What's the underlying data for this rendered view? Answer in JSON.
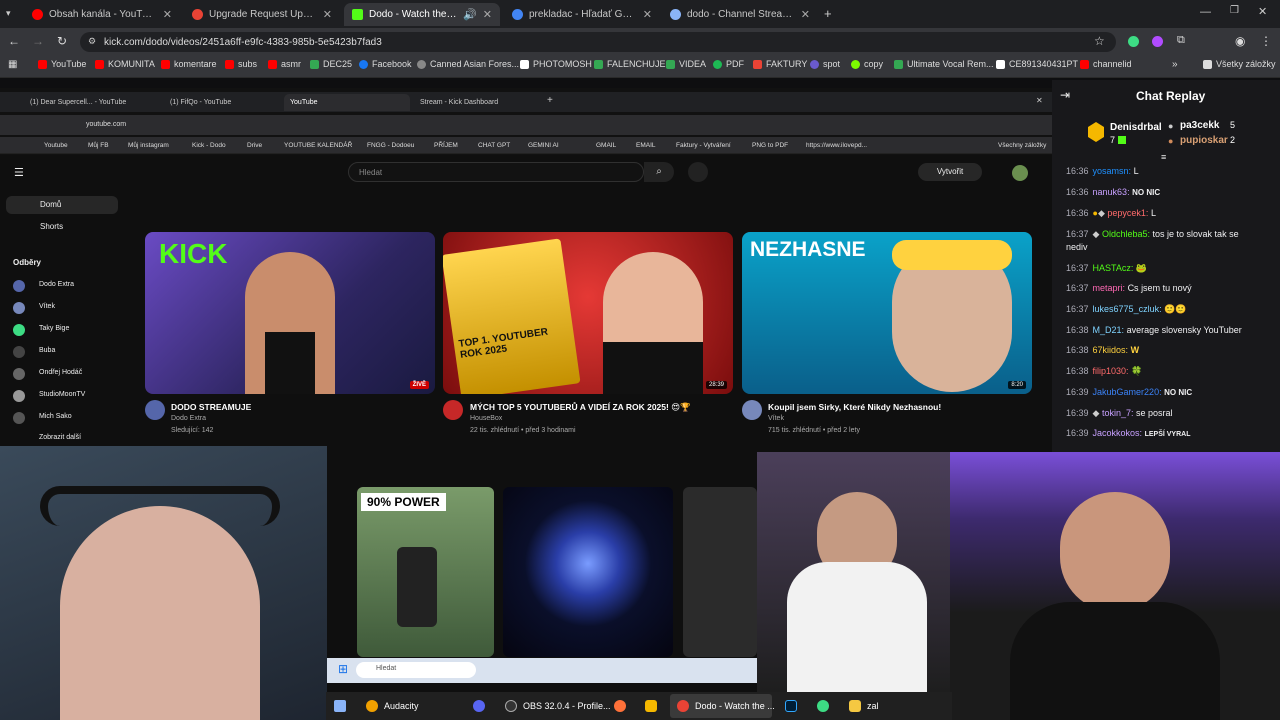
{
  "browser": {
    "tabs": [
      {
        "label": "Obsah kanála - YouTube Studio",
        "color": "#ff0000"
      },
      {
        "label": "Upgrade Request Update - fifq",
        "color": "#ea4335"
      },
      {
        "label": "Dodo - Watch the VOD on",
        "color": "#53fc18"
      },
      {
        "label": "prekladac - Hľadať Googlom",
        "color": "#4285f4"
      },
      {
        "label": "dodo - Channel Streams on Kic",
        "color": "#8ab4f8"
      }
    ],
    "url": "kick.com/dodo/videos/2451a6ff-e9fc-4383-985b-5e5423b7fad3",
    "bookmarks": [
      "YouTube",
      "KOMUNITA",
      "komentare",
      "subs",
      "asmr",
      "DEC25",
      "Facebook",
      "Canned Asian Fores...",
      "PHOTOMOSH",
      "FALENCHUJE",
      "VIDEA",
      "PDF",
      "FAKTURY",
      "spot",
      "copy",
      "Ultimate Vocal Rem...",
      "CE891340431PT",
      "channelid"
    ],
    "all_bookmarks": "Všetky záložky"
  },
  "inner": {
    "tabs": [
      "(1) Dear Supercell... - YouTube",
      "(1) FifQo - YouTube",
      "YouTube",
      "Stream - Kick Dashboard"
    ],
    "url": "youtube.com",
    "bookmarks": [
      "Youtube",
      "Můj FB",
      "Můj instagram",
      "Kick - Dodo",
      "Drive",
      "YOUTUBE KALENDÁŘ",
      "FNGG - Dodoeu",
      "PŘÍJEM",
      "CHAT GPT",
      "GEMINI AI",
      "GMAIL",
      "EMAIL",
      "Faktury - Vytváření",
      "PNG to PDF",
      "https://www.ilovepd..."
    ],
    "all_bookmarks": "Všechny záložky",
    "search_placeholder": "Hledat",
    "create_label": "Vytvořit",
    "sidebar": {
      "home": "Domů",
      "shorts": "Shorts",
      "subs": "Odběry",
      "channels": [
        "Dodo Extra",
        "Vítek",
        "Taky Bige",
        "Buba",
        "Ondřej Hodáč",
        "StudioMoonTV",
        "Mich Sako"
      ],
      "show_all": "Zobrazit další"
    },
    "videos": [
      {
        "title": "DODO STREAMUJE",
        "channel": "Dodo Extra",
        "meta": "Sledující: 142",
        "badge": "ŽIVĚ",
        "thumb_text": "KICK"
      },
      {
        "title": "MÝCH TOP 5 YOUTUBERŮ A VIDEÍ ZA ROK 2025! 😍🏆",
        "channel": "HouseBox",
        "meta": "22 tis. zhlédnutí • před 3 hodinami",
        "badge": "28:39",
        "thumb_text": "TOP 1. YOUTUBER ROK 2025"
      },
      {
        "title": "Koupil jsem Sirky, Které Nikdy Nezhasnou!",
        "channel": "Vítek",
        "meta": "715 tis. zhlédnutí • před 2 lety",
        "badge": "8:20",
        "thumb_text": "NEZHASNE"
      }
    ],
    "shorts_thumb": "90% POWER",
    "win_search": "Hledat"
  },
  "chat": {
    "title": "Chat Replay",
    "leaders": [
      {
        "name": "Denisdrbal",
        "count": "7"
      },
      {
        "name": "pa3cekk",
        "count": "5"
      },
      {
        "name": "pupioskar",
        "count": "2"
      }
    ],
    "messages": [
      {
        "time": "16:36",
        "user": "yosamsn:",
        "text": "L",
        "color": "#1e90ff"
      },
      {
        "time": "16:36",
        "user": "nanuk63:",
        "text": "NO NIC",
        "color": "#c7a0ff"
      },
      {
        "time": "16:36",
        "user": "pepycek1:",
        "text": "L",
        "color": "#ff6b6b"
      },
      {
        "time": "16:37",
        "user": "Oldchleba5:",
        "text": "tos je to slovak tak se",
        "text2": "nediv",
        "color": "#53fc18"
      },
      {
        "time": "16:37",
        "user": "HASTAcz:",
        "text": "🐸",
        "color": "#53fc18"
      },
      {
        "time": "16:37",
        "user": "metapri:",
        "text": "Cs jsem tu nový",
        "color": "#ff69b4"
      },
      {
        "time": "16:37",
        "user": "lukes6775_czluk:",
        "text": "🙂🙂",
        "color": "#7fd3ff"
      },
      {
        "time": "16:38",
        "user": "M_D21:",
        "text": "average slovensky YouTuber",
        "color": "#7fd3ff"
      },
      {
        "time": "16:38",
        "user": "67kiidos:",
        "text": "W",
        "color": "#ffd23f"
      },
      {
        "time": "16:38",
        "user": "filip1030:",
        "text": "🍀",
        "color": "#ff6b6b"
      },
      {
        "time": "16:39",
        "user": "JakubGamer220:",
        "text": "NO NIC",
        "color": "#3b82f6"
      },
      {
        "time": "16:39",
        "user": "tokin_7:",
        "text": "se posral",
        "color": "#c7a0ff"
      },
      {
        "time": "16:39",
        "user": "Jacokkokos:",
        "text": "LEPŠÍ VYRAL",
        "color": "#c7a0ff"
      }
    ]
  },
  "taskbar": {
    "items": [
      "Audacity",
      "OBS 32.0.4 - Profile...",
      "Dodo - Watch the ...",
      "zal"
    ]
  }
}
